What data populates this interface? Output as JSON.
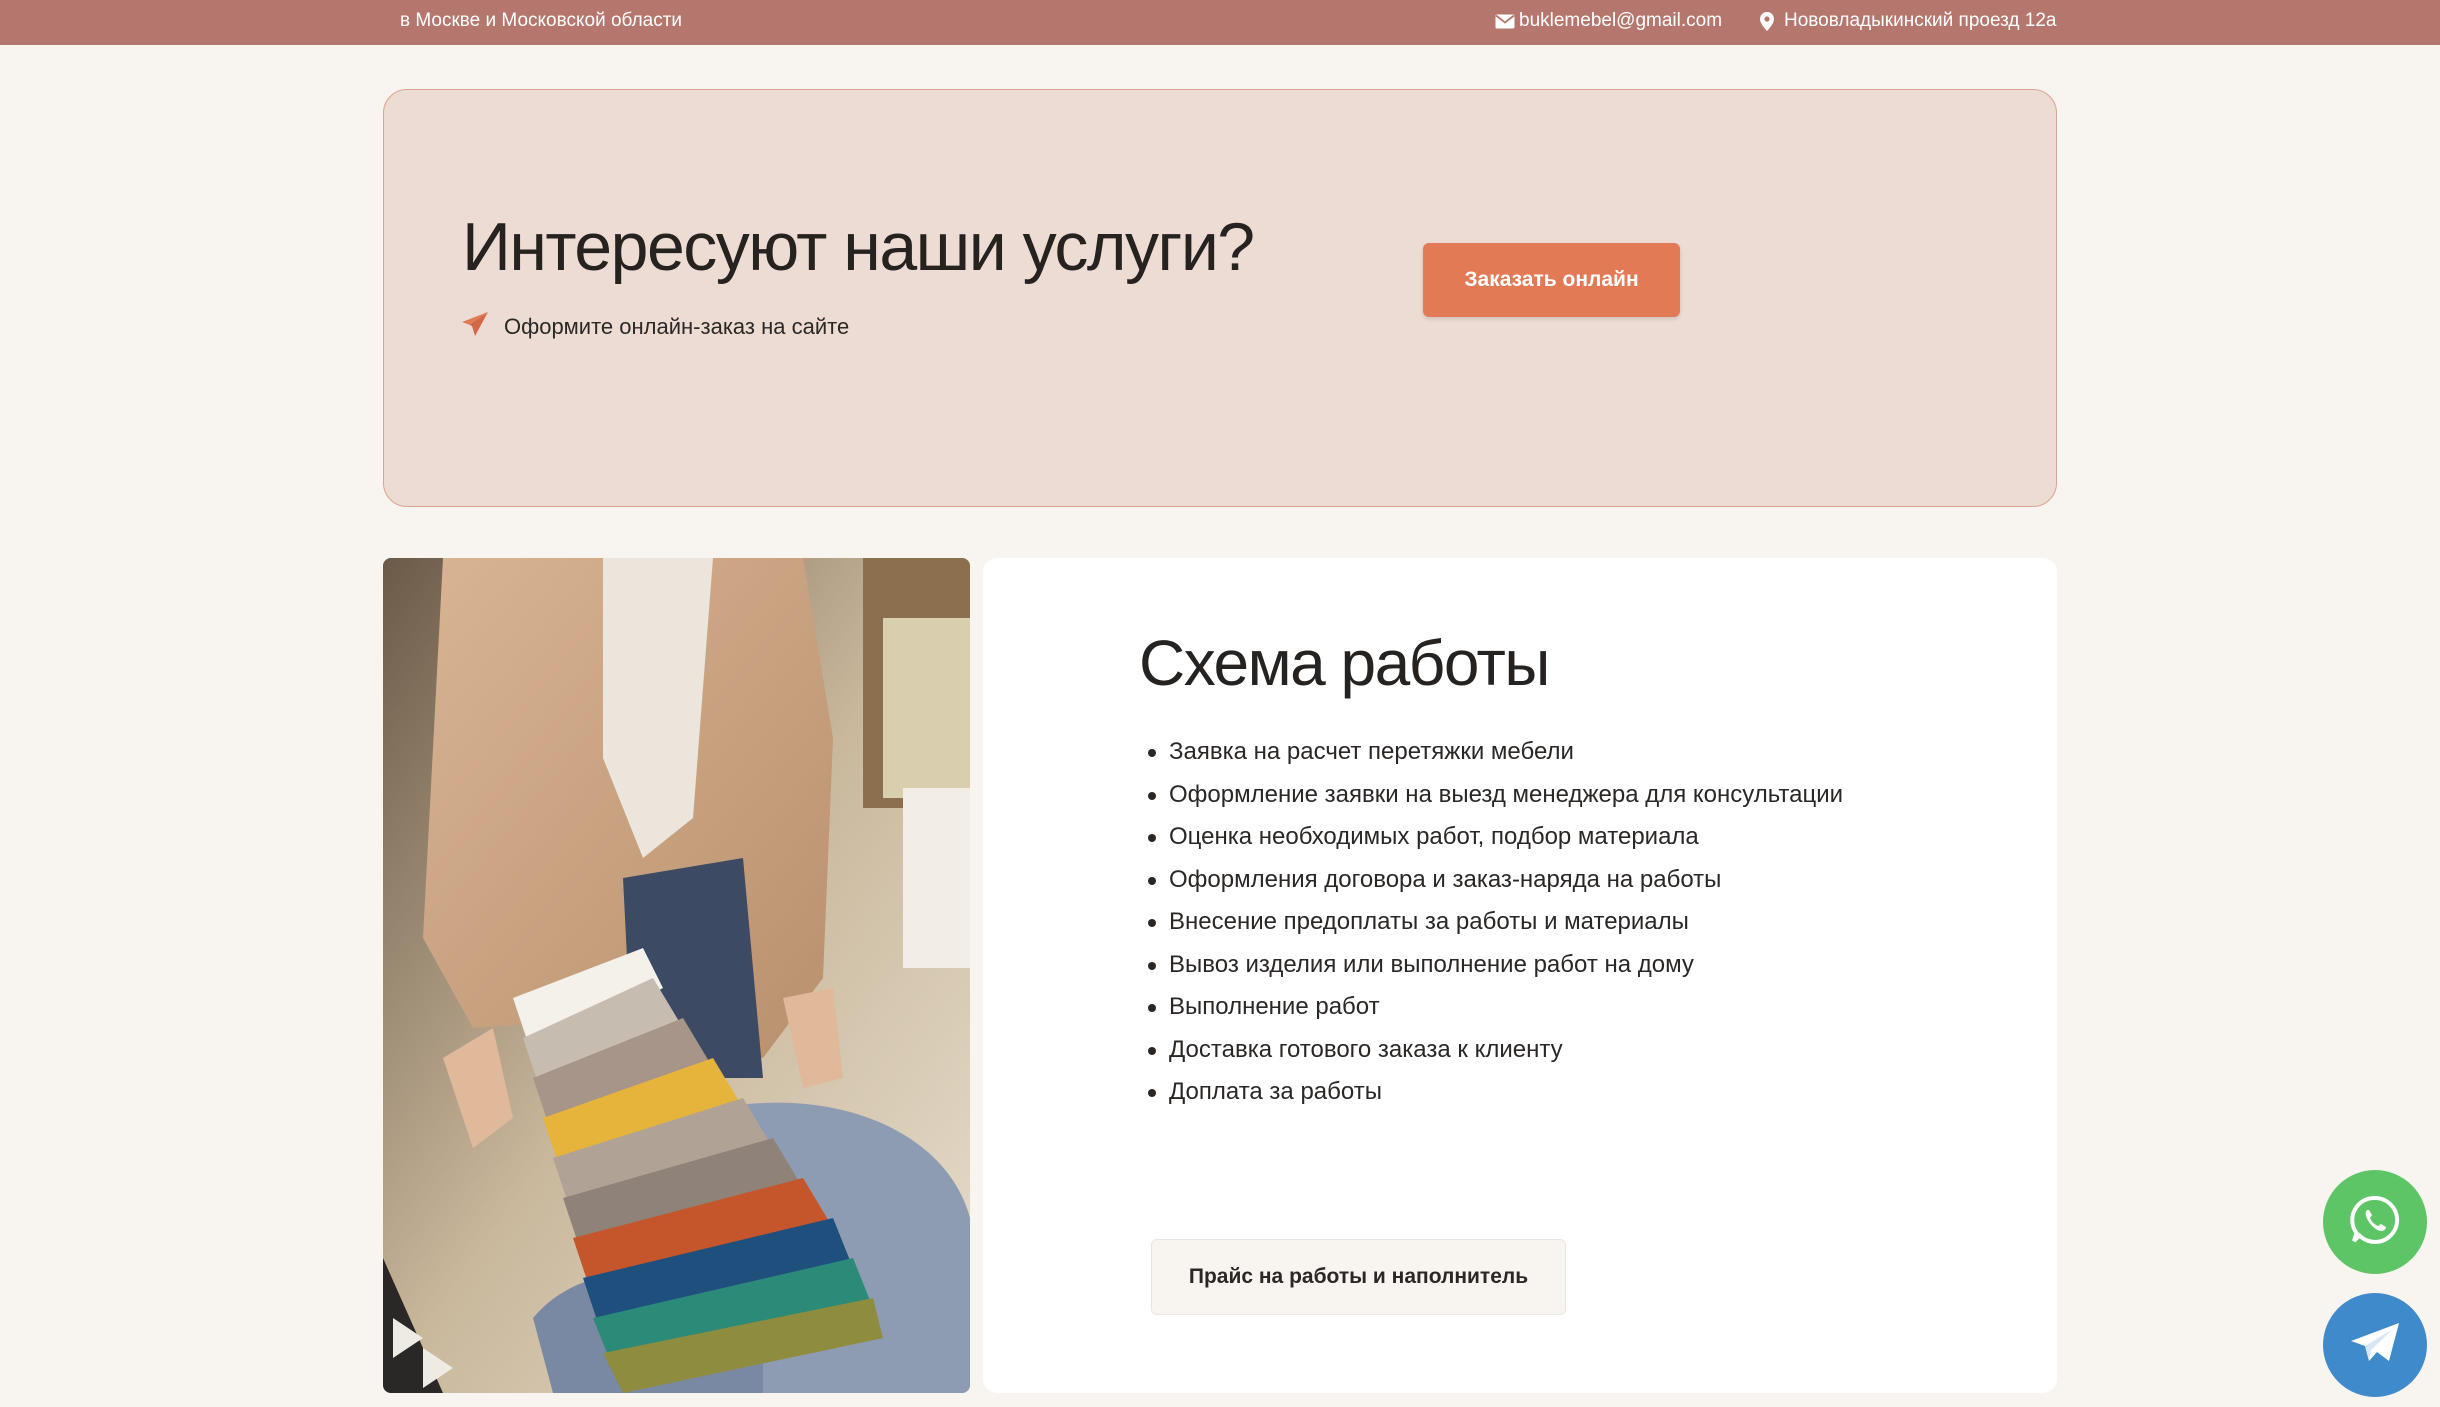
{
  "topbar": {
    "region": "в Москве и Московской области",
    "email": "buklemebel@gmail.com",
    "address": "Нововладыкинский проезд 12а"
  },
  "cta": {
    "title": "Интересуют наши услуги?",
    "subtitle": "Оформите онлайн-заказ на сайте",
    "button": "Заказать онлайн"
  },
  "scheme": {
    "title": "Схема работы",
    "steps": [
      "Заявка на расчет перетяжки мебели",
      "Оформление заявки на выезд менеджера для  консультации",
      "Оценка необходимых работ, подбор материала",
      "Оформления договора и заказ-наряда на работы",
      "Внесение предоплаты за работы и материалы",
      "Вывоз изделия или выполнение работ на дому",
      "Выполнение работ",
      "Доставка готового заказа к клиенту",
      "Доплата за работы"
    ],
    "price_button": "Прайс на работы и наполнитель"
  },
  "colors": {
    "topbar": "#b5776d",
    "accent": "#e27a56",
    "cta_background": "#ecdcd3",
    "whatsapp": "#5dc565",
    "telegram": "#3f8acb"
  },
  "icons": {
    "email": "envelope-icon",
    "address": "map-pin-icon",
    "subtitle": "paper-plane-icon",
    "whatsapp": "whatsapp-icon",
    "telegram": "telegram-icon"
  }
}
